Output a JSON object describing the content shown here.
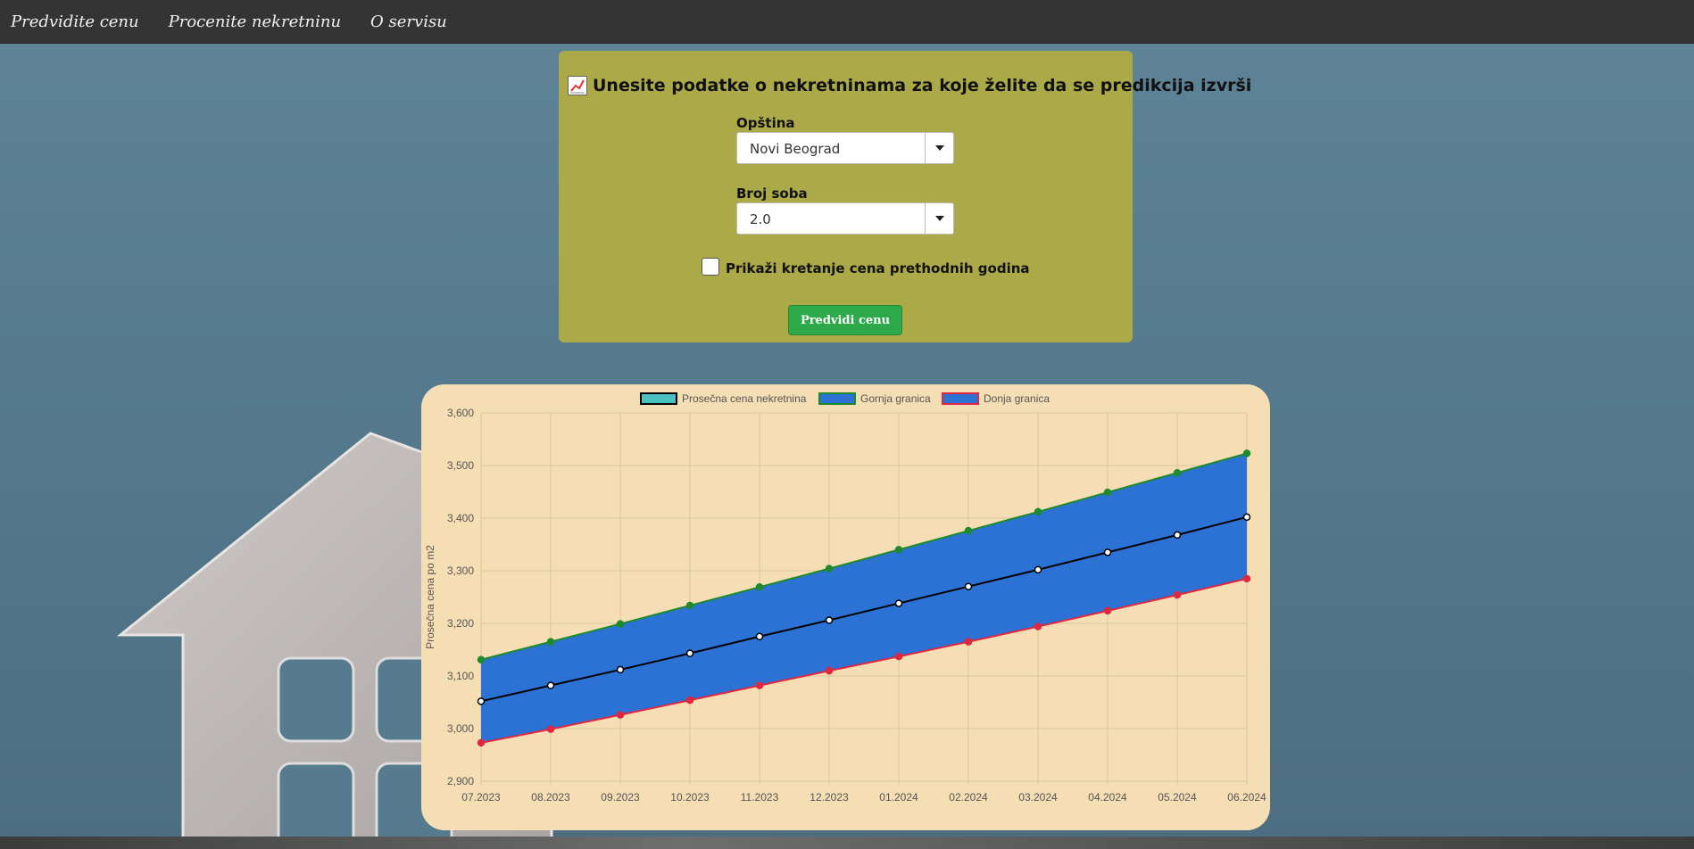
{
  "nav": {
    "items": [
      "Predvidite cenu",
      "Procenite nekretninu",
      "O servisu"
    ]
  },
  "form": {
    "title": "Unesite podatke o nekretninama za koje želite da se predikcija izvrši",
    "municipality_label": "Opština",
    "municipality_value": "Novi Beograd",
    "rooms_label": "Broj soba",
    "rooms_value": "2.0",
    "history_checkbox_label": "Prikaži kretanje cena prethodnih godina",
    "history_checked": false,
    "submit_label": "Predvidi cenu"
  },
  "colors": {
    "form_bg": "#aca948",
    "chart_bg": "#f5deb3",
    "band_fill": "#2b72d4",
    "upper_line": "#1e8a2e",
    "lower_line": "#e0273f",
    "avg_line": "#000000",
    "avg_legend_fill": "#4bc0c0",
    "button": "#2ea94a"
  },
  "chart_data": {
    "type": "line",
    "categories": [
      "07.2023",
      "08.2023",
      "09.2023",
      "10.2023",
      "11.2023",
      "12.2023",
      "01.2024",
      "02.2024",
      "03.2024",
      "04.2024",
      "05.2024",
      "06.2024"
    ],
    "series": [
      {
        "name": "Prosečna cena nekretnina",
        "values": [
          3052,
          3082,
          3112,
          3143,
          3175,
          3206,
          3238,
          3270,
          3302,
          3335,
          3368,
          3402
        ]
      },
      {
        "name": "Gornja granica",
        "values": [
          3131,
          3165,
          3199,
          3234,
          3269,
          3304,
          3340,
          3376,
          3412,
          3449,
          3486,
          3523
        ]
      },
      {
        "name": "Donja granica",
        "values": [
          2973,
          2999,
          3026,
          3054,
          3082,
          3110,
          3137,
          3165,
          3194,
          3224,
          3254,
          3285
        ]
      }
    ],
    "ylabel": "Prosečna cena po m2",
    "xlabel": "",
    "ylim": [
      2900,
      3600
    ],
    "yticks": [
      2900,
      3000,
      3100,
      3200,
      3300,
      3400,
      3500,
      3600
    ],
    "grid": true,
    "legend": "top"
  }
}
